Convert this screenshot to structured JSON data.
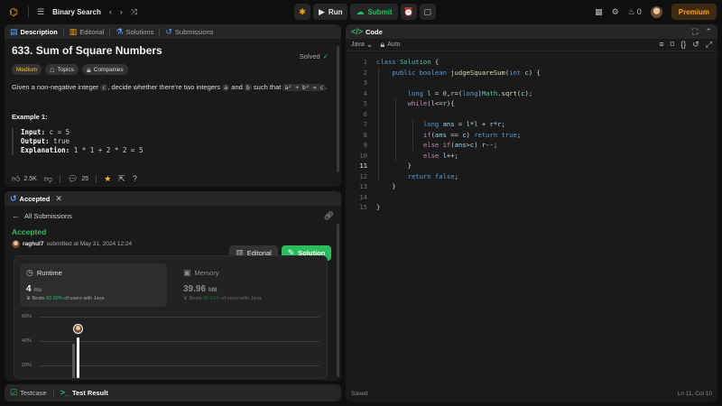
{
  "topbar": {
    "problem_list_label": "Binary Search",
    "run_label": "Run",
    "submit_label": "Submit",
    "streak_count": "0",
    "premium_label": "Premium"
  },
  "description_panel": {
    "tabs": [
      {
        "label": "Description"
      },
      {
        "label": "Editorial"
      },
      {
        "label": "Solutions"
      },
      {
        "label": "Submissions"
      }
    ],
    "title": "633. Sum of Square Numbers",
    "status": "Solved",
    "tags": [
      {
        "label": "Medium"
      },
      {
        "label": "Topics"
      },
      {
        "label": "Companies"
      }
    ],
    "text_parts": [
      "Given a non-negative integer",
      "c",
      ", decide whether there're two integers",
      "a",
      "and",
      "b",
      "such that",
      "a² + b² = c",
      "."
    ],
    "example_heading": "Example 1:",
    "example": {
      "input_label": "Input:",
      "input_value": "c = 5",
      "output_label": "Output:",
      "output_value": "true",
      "explanation_label": "Explanation:",
      "explanation_value": "1 * 1 + 2 * 2 = 5"
    },
    "footer": {
      "likes": "2.5K",
      "comments": "25"
    }
  },
  "result_panel": {
    "tab_label": "Accepted",
    "all_submissions_label": "All Submissions",
    "status": "Accepted",
    "user": "raghul7",
    "submitted_text": "submitted at May 31, 2024 12:24",
    "editorial_button": "Editorial",
    "solution_button": "Solution",
    "runtime": {
      "label": "Runtime",
      "value": "4",
      "unit": "ms",
      "beats_prefix": "Beats",
      "beats_pct": "60.99%",
      "beats_suffix": "of users with Java"
    },
    "memory": {
      "label": "Memory",
      "value": "39.96",
      "unit": "MB",
      "beats_prefix": "Beats",
      "beats_pct": "90.61%",
      "beats_suffix": "of users with Java"
    },
    "chart_ticks": [
      "60%",
      "40%",
      "20%"
    ]
  },
  "bottom_tabs": {
    "testcase_label": "Testcase",
    "result_label": "Test Result"
  },
  "code_panel": {
    "tab_label": "Code",
    "language": "Java",
    "mode": "Auto",
    "saved_label": "Saved",
    "cursor_position": "Ln 11, Col 10",
    "current_line": 11,
    "lines": [
      "class Solution {",
      "    public boolean judgeSquareSum(int c) {",
      "",
      "        long l = 0,r=(long)Math.sqrt(c);",
      "        while(l<=r){",
      "",
      "            long ans = l*l + r*r;",
      "            if(ans == c) return true;",
      "            else if(ans>c) r--;",
      "            else l++;",
      "        }",
      "        return false;",
      "    }",
      "",
      "}"
    ]
  }
}
